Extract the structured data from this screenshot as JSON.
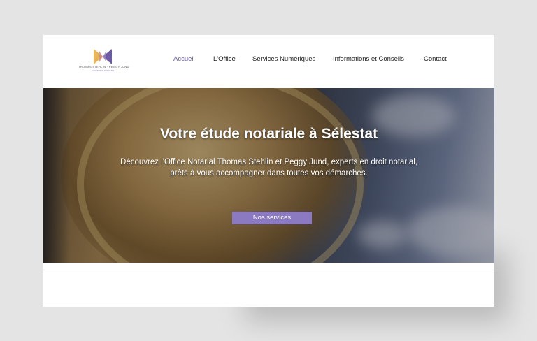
{
  "logo": {
    "name": "THOMAS STEHLIN · PEGGY JUND",
    "subtitle": "NOTAIRES ASSOCIÉS",
    "icon": "bowtie-logo-icon",
    "colors": {
      "gold": "#e8b45a",
      "purple": "#6b5aa6"
    }
  },
  "nav": {
    "items": [
      {
        "label": "Accueil",
        "active": true
      },
      {
        "label": "L'Office",
        "active": false
      },
      {
        "label": "Services Numériques",
        "active": false
      },
      {
        "label": "Informations et Conseils",
        "active": false
      },
      {
        "label": "Contact",
        "active": false
      }
    ]
  },
  "hero": {
    "title": "Votre étude notariale à Sélestat",
    "text_line1": "Découvrez l'Office Notarial Thomas Stehlin et Peggy Jund, experts en droit notarial,",
    "text_line2": "prêts à vous accompagner dans toutes vos démarches.",
    "button_label": "Nos services"
  },
  "theme": {
    "accent": "#6b5aa6",
    "button": "#8b79c2",
    "background": "#e4e4e4"
  }
}
